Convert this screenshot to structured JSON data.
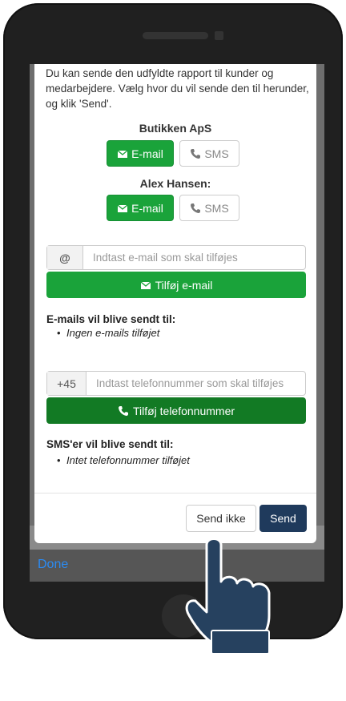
{
  "modal": {
    "intro_text": "Du kan sende den udfyldte rapport til kunder og medarbejdere. Vælg hvor du vil sende den til herunder, og klik 'Send'.",
    "recipients": [
      {
        "name": "Butikken ApS",
        "email_label": "E-mail",
        "sms_label": "SMS"
      },
      {
        "name": "Alex Hansen:",
        "email_label": "E-mail",
        "sms_label": "SMS"
      }
    ],
    "email_input": {
      "addon": "@",
      "placeholder": "Indtast e-mail som skal tilføjes",
      "button_label": "Tilføj e-mail"
    },
    "email_list": {
      "title": "E-mails vil blive sendt til:",
      "empty_text": "Ingen e-mails tilføjet"
    },
    "phone_input": {
      "addon": "+45",
      "placeholder": "Indtast telefonnummer som skal tilføjes",
      "button_label": "Tilføj telefonnummer"
    },
    "sms_list": {
      "title": "SMS'er vil blive sendt til:",
      "empty_text": "Intet telefonnummer tilføjet"
    },
    "footer": {
      "cancel_label": "Send ikke",
      "send_label": "Send"
    }
  },
  "keyboard_bar": {
    "done_label": "Done"
  },
  "colors": {
    "green": "#1aa33a",
    "dark_green": "#127a24",
    "navy": "#1f3a5c",
    "done_blue": "#2b8bf2"
  },
  "icons": {
    "email": "envelope-icon",
    "sms": "phone-icon",
    "pointer": "pointing-hand-icon"
  }
}
